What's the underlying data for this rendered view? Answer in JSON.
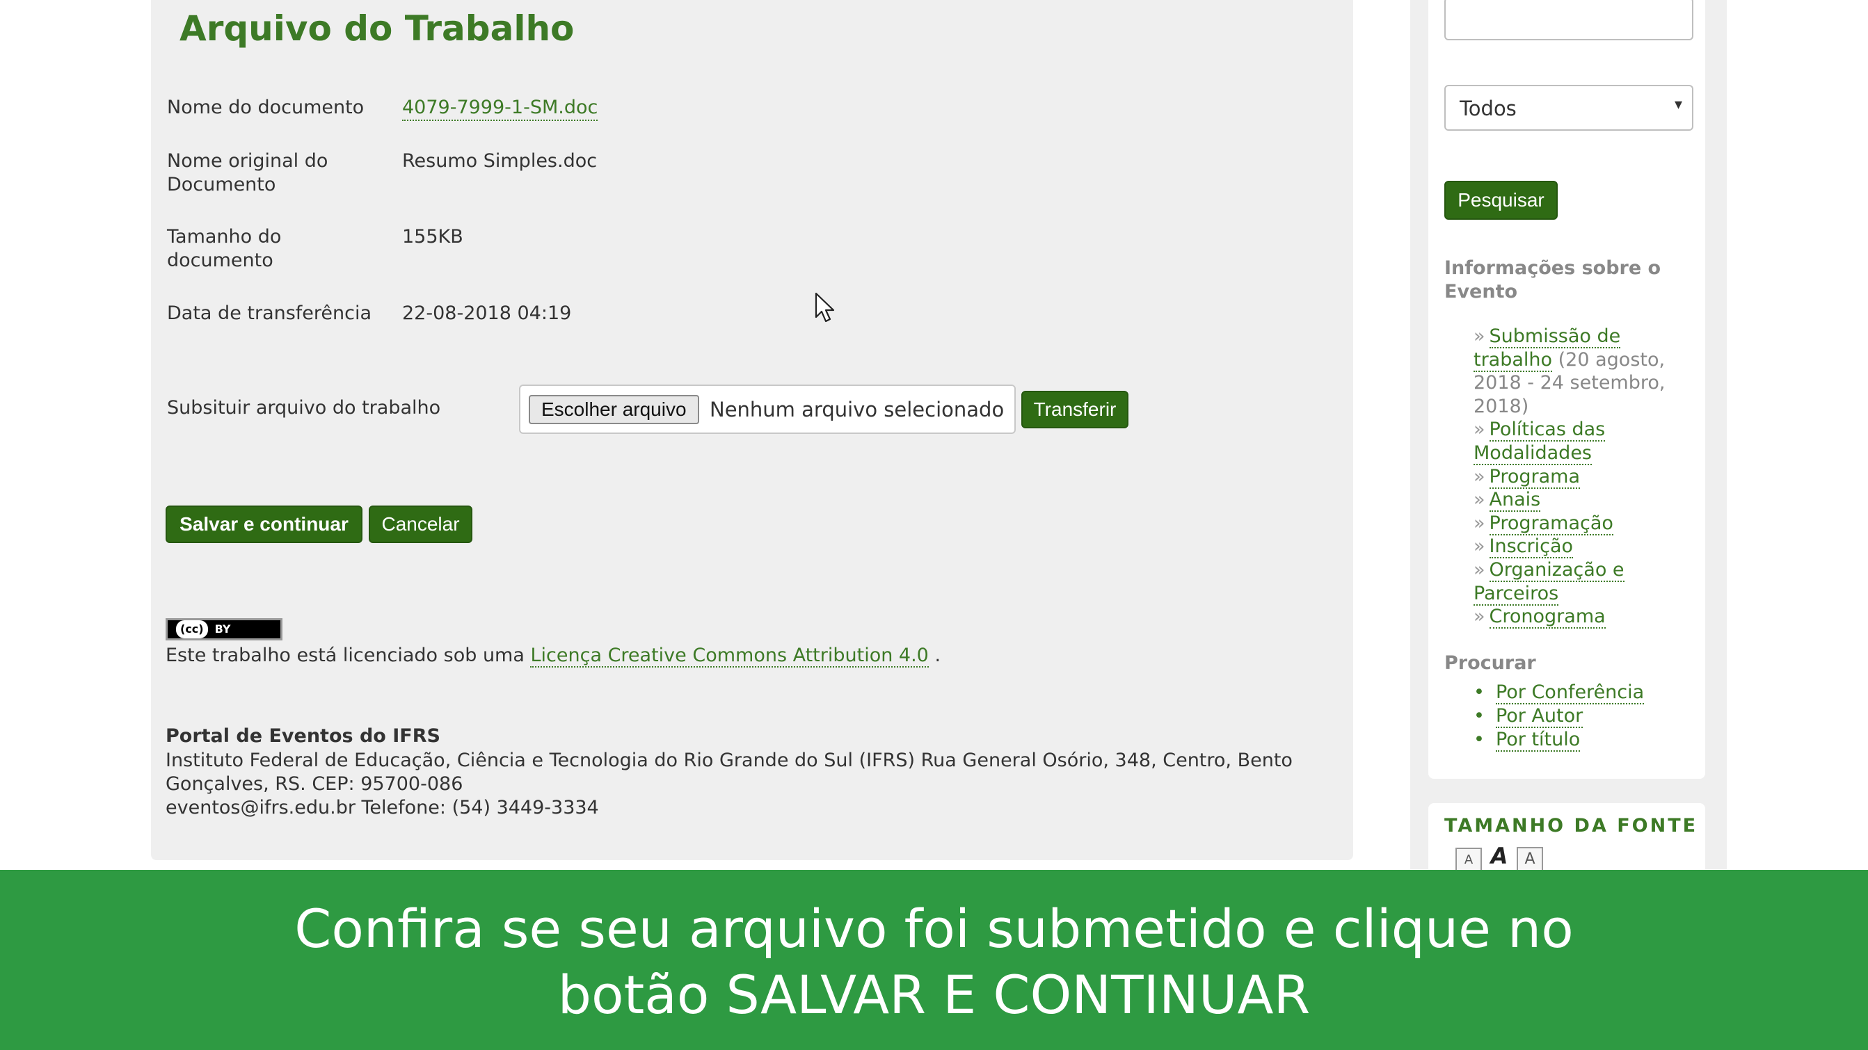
{
  "page": {
    "title": "Arquivo do Trabalho"
  },
  "details": {
    "doc_name_label": "Nome do documento",
    "doc_name_value": "4079-7999-1-SM.doc",
    "original_name_label_line1": "Nome original do",
    "original_name_label_line2": "Documento",
    "original_name_value": "Resumo Simples.doc",
    "size_label_line1": "Tamanho do",
    "size_label_line2": "documento",
    "size_value": "155KB",
    "date_label": "Data de transferência",
    "date_value": "22-08-2018 04:19"
  },
  "upload": {
    "label": "Subsituir arquivo do trabalho",
    "choose_button": "Escolher arquivo",
    "no_file_text": "Nenhum arquivo selecionado",
    "transfer_button": "Transferir"
  },
  "actions": {
    "save_button": "Salvar e continuar",
    "cancel_button": "Cancelar"
  },
  "license": {
    "badge_cc": "(cc)",
    "badge_by": "BY",
    "text_prefix": "Este trabalho está licenciado sob uma ",
    "link": "Licença Creative Commons Attribution 4.0",
    "text_suffix": " ."
  },
  "footer": {
    "title": "Portal de Eventos do IFRS",
    "line1": "Instituto Federal de Educação, Ciência e Tecnologia do Rio Grande do Sul (IFRS) Rua General Osório, 348, Centro, Bento",
    "line2": "Gonçalves, RS. CEP: 95700-086",
    "line3": "eventos@ifrs.edu.br Telefone: (54) 3449-3334"
  },
  "sidebar": {
    "search_input_value": "",
    "select_value": "Todos",
    "select_arrow": "▾",
    "search_button": "Pesquisar",
    "info_heading_line1": "Informações sobre o",
    "info_heading_line2": "Evento",
    "nav": {
      "submission_line1": "Submissão de",
      "submission_line2": "trabalho",
      "submission_note_a": " (20 agosto,",
      "submission_note_b": "2018 - 24 setembro,",
      "submission_note_c": "2018)",
      "policies_line1": "Políticas das",
      "policies_line2": "Modalidades",
      "program": "Programa",
      "annals": "Anais",
      "schedule_prog": "Programação",
      "registration": "Inscrição",
      "org_line1": "Organização e",
      "org_line2": "Parceiros",
      "timeline": "Cronograma"
    },
    "raquo": "»",
    "search_heading": "Procurar",
    "search_links": {
      "by_conference": "Por Conferência",
      "by_author": "Por Autor",
      "by_title": "Por título"
    },
    "bullet": "•",
    "font_heading": "TAMANHO DA FONTE",
    "font_icons": {
      "smaller": "A",
      "normal": "A",
      "larger": "A"
    }
  },
  "caption": {
    "line1": "Confira se seu arquivo foi submetido e clique no",
    "line2": "botão SALVAR E CONTINUAR"
  },
  "colors": {
    "accent_green": "#3d7a26",
    "button_green": "#2f6b14",
    "caption_green": "#2e9a42"
  }
}
